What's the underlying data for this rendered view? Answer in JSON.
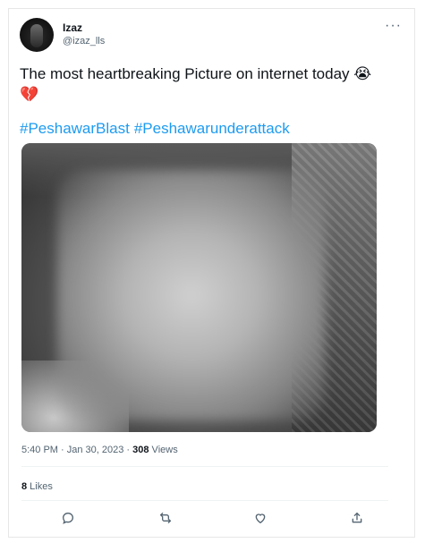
{
  "author": {
    "name": "Izaz",
    "handle": "@izaz_lls"
  },
  "tweet": {
    "text": "The most heartbreaking Picture on internet today",
    "emoji_1": "😭",
    "emoji_2": "💔",
    "hashtags": [
      "#PeshawarBlast",
      "#Peshawarunderattack"
    ]
  },
  "meta": {
    "time_date": "5:40 PM · Jan 30, 2023 · ",
    "views_count": "308",
    "views_label": " Views"
  },
  "stats": {
    "likes_count": "8",
    "likes_label": " Likes"
  },
  "icons": {
    "more": "more-icon",
    "reply": "reply-icon",
    "retweet": "retweet-icon",
    "like": "heart-icon",
    "share": "share-icon"
  },
  "colors": {
    "link": "#1d9bf0",
    "muted": "#536471",
    "text": "#0f1419"
  }
}
